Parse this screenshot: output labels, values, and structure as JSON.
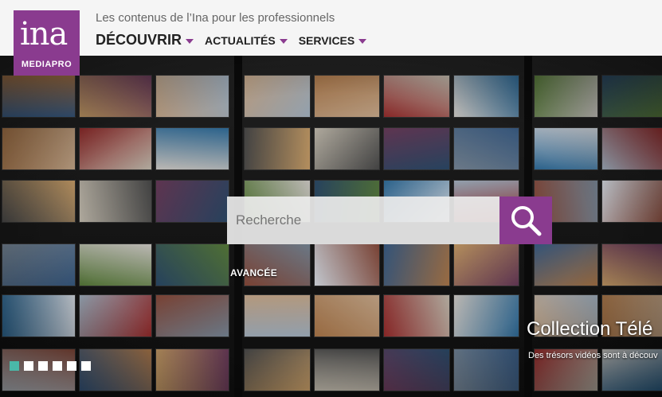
{
  "header": {
    "logo_main": "ina",
    "logo_sub": "MEDIAPRO",
    "tagline": "Les contenus de l’Ina pour les professionnels",
    "nav": [
      {
        "label": "DÉCOUVRIR"
      },
      {
        "label": "ACTUALITÉS"
      },
      {
        "label": "SERVICES"
      }
    ]
  },
  "search": {
    "placeholder": "Recherche",
    "advanced_label": "AVANCÉE"
  },
  "slider": {
    "title": "Collection Télé",
    "subtitle": "Des trésors vidéos sont à découv",
    "slide_count": 6,
    "active_index": 0
  },
  "colors": {
    "brand": "#8a3b8f",
    "active_dot": "#4ab8a8"
  }
}
